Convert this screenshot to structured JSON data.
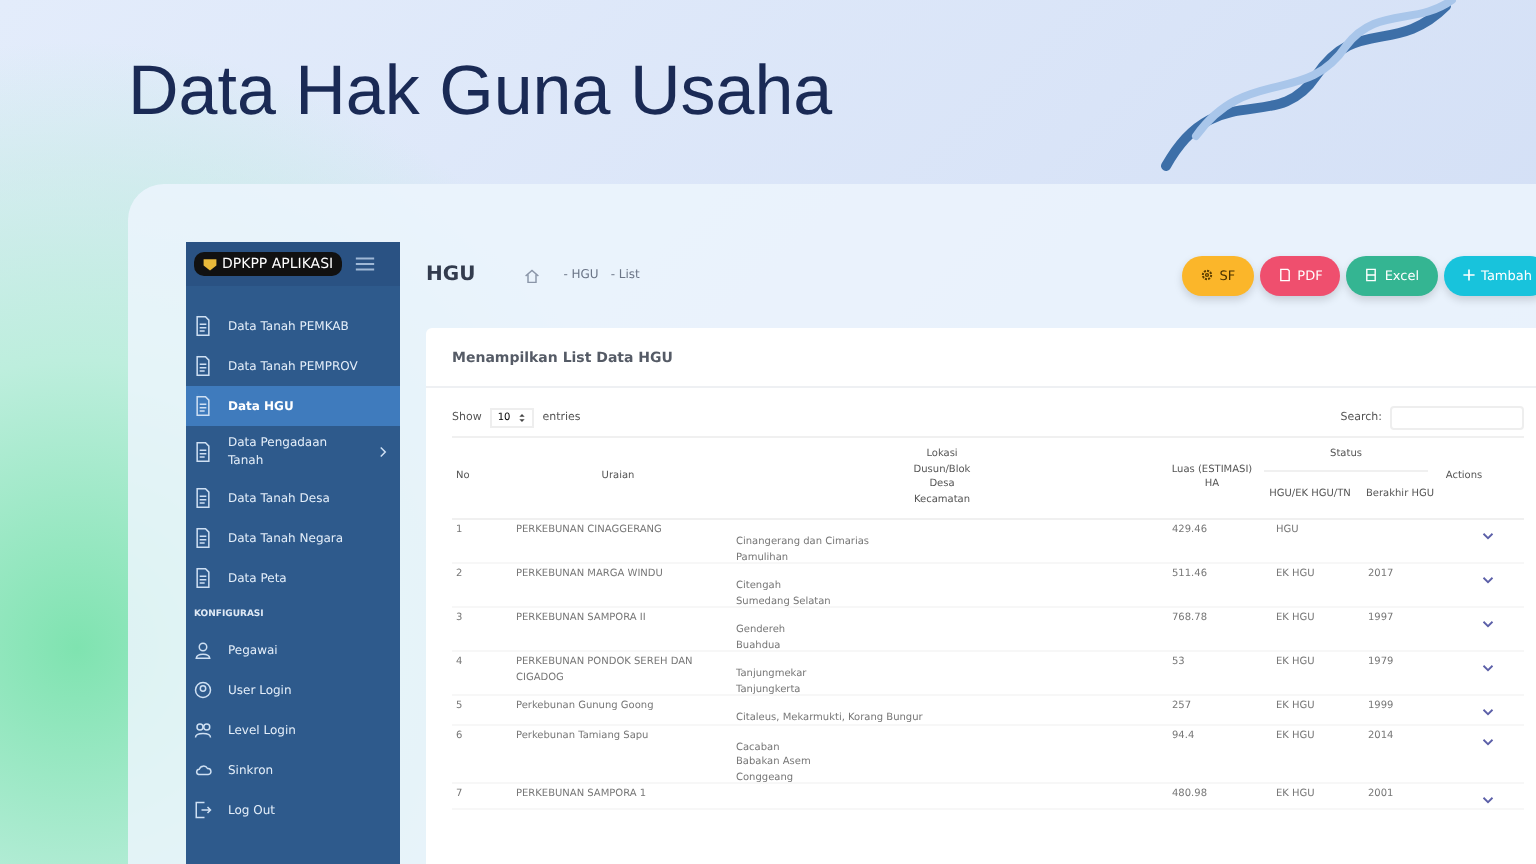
{
  "page_title": "Data Hak Guna Usaha",
  "sidebar": {
    "brand": "DPKPP APLIKASI",
    "menu": [
      {
        "label": "Data Tanah PEMKAB",
        "selected": false,
        "expandable": false
      },
      {
        "label": "Data Tanah PEMPROV",
        "selected": false,
        "expandable": false
      },
      {
        "label": "Data HGU",
        "selected": true,
        "expandable": false
      },
      {
        "label": "Data Pengadaan Tanah",
        "selected": false,
        "expandable": true
      },
      {
        "label": "Data Tanah Desa",
        "selected": false,
        "expandable": false
      },
      {
        "label": "Data Tanah Negara",
        "selected": false,
        "expandable": false
      },
      {
        "label": "Data Peta",
        "selected": false,
        "expandable": false
      }
    ],
    "section_label": "KONFIGURASI",
    "config_menu": [
      {
        "label": "Pegawai",
        "selected": false
      },
      {
        "label": "User Login",
        "selected": false
      },
      {
        "label": "Level Login",
        "selected": false
      },
      {
        "label": "Sinkron",
        "selected": false
      },
      {
        "label": "Log Out",
        "selected": false
      }
    ]
  },
  "header": {
    "title": "HGU",
    "breadcrumb": [
      "- HGU",
      "- List"
    ],
    "buttons": [
      {
        "label": "SF",
        "kind": "settings",
        "color": "#fbb62a"
      },
      {
        "label": "PDF",
        "kind": "pdf",
        "color": "#ef4f6e"
      },
      {
        "label": "Excel",
        "kind": "excel",
        "color": "#34b592"
      },
      {
        "label": "Tambah",
        "kind": "add",
        "color": "#18c3dc"
      }
    ]
  },
  "card": {
    "title": "Menampilkan List Data HGU",
    "show_label": "Show",
    "page_size": "10",
    "entries_label": "entries",
    "search_label": "Search:",
    "table": {
      "columns": {
        "no": "No",
        "uraian": "Uraian",
        "lokasi": [
          "Lokasi",
          "Dusun/Blok",
          "Desa",
          "Kecamatan"
        ],
        "luas": "Luas (ESTIMASI) HA",
        "status": "Status",
        "status_type": "HGU/EK HGU/TN",
        "berakhir": "Berakhir HGU",
        "actions": "Actions"
      },
      "rows": [
        {
          "no": "1",
          "uraian": "PERKEBUNAN CINAGGERANG",
          "lokasi": [
            "Cinangerang dan Cimarias",
            "Pamulihan"
          ],
          "luas": "429.46",
          "status": "HGU",
          "berakhir": ""
        },
        {
          "no": "2",
          "uraian": "PERKEBUNAN MARGA WINDU",
          "lokasi": [
            "Citengah",
            "Sumedang Selatan"
          ],
          "luas": "511.46",
          "status": "EK HGU",
          "berakhir": "2017"
        },
        {
          "no": "3",
          "uraian": "PERKEBUNAN SAMPORA II",
          "lokasi": [
            "Gendereh",
            "Buahdua"
          ],
          "luas": "768.78",
          "status": "EK HGU",
          "berakhir": "1997"
        },
        {
          "no": "4",
          "uraian": "PERKEBUNAN PONDOK SEREH DAN CIGADOG",
          "lokasi": [
            "Tanjungmekar",
            "Tanjungkerta"
          ],
          "luas": "53",
          "status": "EK HGU",
          "berakhir": "1979"
        },
        {
          "no": "5",
          "uraian": "Perkebunan Gunung Goong",
          "lokasi": [
            "Citaleus, Mekarmukti, Korang Bungur"
          ],
          "luas": "257",
          "status": "EK HGU",
          "berakhir": "1999"
        },
        {
          "no": "6",
          "uraian": "Perkebunan Tamiang Sapu",
          "lokasi": [
            "Cacaban",
            "Babakan Asem",
            "Conggeang"
          ],
          "luas": "94.4",
          "status": "EK HGU",
          "berakhir": "2014"
        },
        {
          "no": "7",
          "uraian": "PERKEBUNAN SAMPORA 1",
          "lokasi": [],
          "luas": "480.98",
          "status": "EK HGU",
          "berakhir": "2001"
        }
      ]
    }
  }
}
